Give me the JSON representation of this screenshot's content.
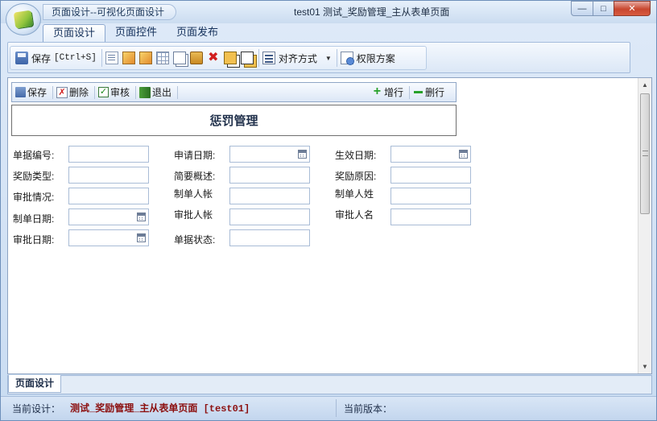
{
  "window": {
    "quick_title": "页面设计--可视化页面设计",
    "title": "test01  测试_奖励管理_主从表单页面",
    "minimize": "—",
    "maximize": "□",
    "close": "✕"
  },
  "ribbon": {
    "tabs": [
      {
        "label": "页面设计",
        "active": true
      },
      {
        "label": "页面控件",
        "active": false
      },
      {
        "label": "页面发布",
        "active": false
      }
    ]
  },
  "toolbar": {
    "save_label": "保存",
    "save_shortcut": "[Ctrl+S]",
    "align_label": "对齐方式",
    "permission_label": "权限方案",
    "icons": [
      "new-page-icon",
      "properties-icon",
      "image-icon",
      "grid-icon",
      "copy-icon",
      "paste-icon",
      "delete-icon",
      "bring-to-front-icon",
      "send-to-back-icon"
    ]
  },
  "form_toolbar": {
    "save": "保存",
    "delete": "删除",
    "audit": "审核",
    "exit": "退出",
    "add_row": "增行",
    "delete_row": "删行"
  },
  "form": {
    "title": "惩罚管理",
    "fields": [
      {
        "label": "单据编号:",
        "value": "",
        "calendar": false
      },
      {
        "label": "申请日期:",
        "value": "",
        "calendar": true
      },
      {
        "label": "生效日期:",
        "value": "",
        "calendar": true
      },
      {
        "label": "奖励类型:",
        "value": "",
        "calendar": false
      },
      {
        "label": "简要概述:",
        "value": "",
        "calendar": false
      },
      {
        "label": "奖励原因:",
        "value": "",
        "calendar": false
      },
      {
        "label": "审批情况:",
        "value": "",
        "calendar": false
      },
      {
        "label": "制单人帐",
        "value": "",
        "calendar": false
      },
      {
        "label": "制单人姓",
        "value": "",
        "calendar": false
      },
      {
        "label": "制单日期:",
        "value": "",
        "calendar": true
      },
      {
        "label": "审批人帐",
        "value": "",
        "calendar": false
      },
      {
        "label": "审批人名",
        "value": "",
        "calendar": false
      },
      {
        "label": "审批日期:",
        "value": "",
        "calendar": true
      },
      {
        "label": "单据状态:",
        "value": "",
        "calendar": false
      }
    ]
  },
  "bottom_tabs": {
    "design": "页面设计"
  },
  "status": {
    "current_design_label": "当前设计：",
    "current_design_value": "测试_奖励管理_主从表单页面 [test01]",
    "current_version_label": "当前版本：",
    "current_version_value": ""
  }
}
